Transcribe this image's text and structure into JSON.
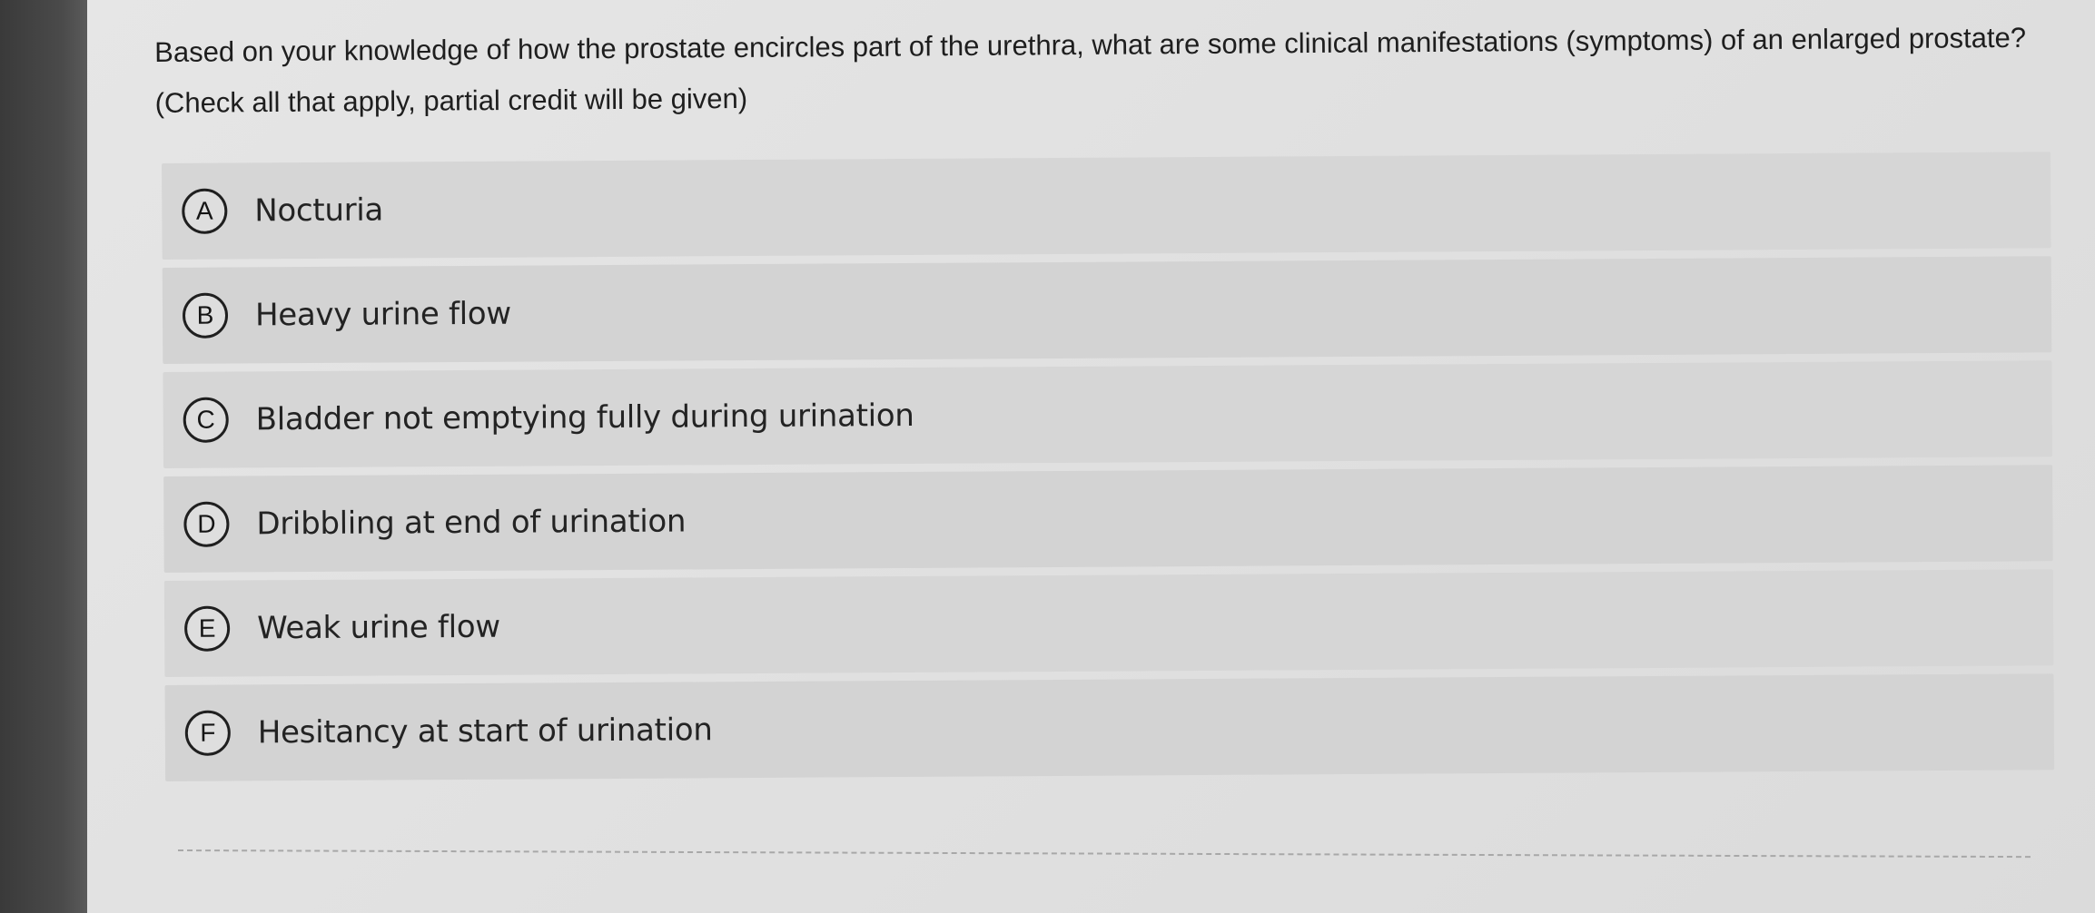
{
  "question": {
    "text": "Based on your knowledge of how the prostate encircles part of the urethra, what are some clinical manifestations (symptoms) of an enlarged prostate? (Check all that apply, partial credit will be given)"
  },
  "options": [
    {
      "letter": "A",
      "label": "Nocturia"
    },
    {
      "letter": "B",
      "label": "Heavy urine flow"
    },
    {
      "letter": "C",
      "label": "Bladder not emptying fully during urination"
    },
    {
      "letter": "D",
      "label": "Dribbling at end of urination"
    },
    {
      "letter": "E",
      "label": "Weak urine flow"
    },
    {
      "letter": "F",
      "label": "Hesitancy at start of urination"
    }
  ]
}
